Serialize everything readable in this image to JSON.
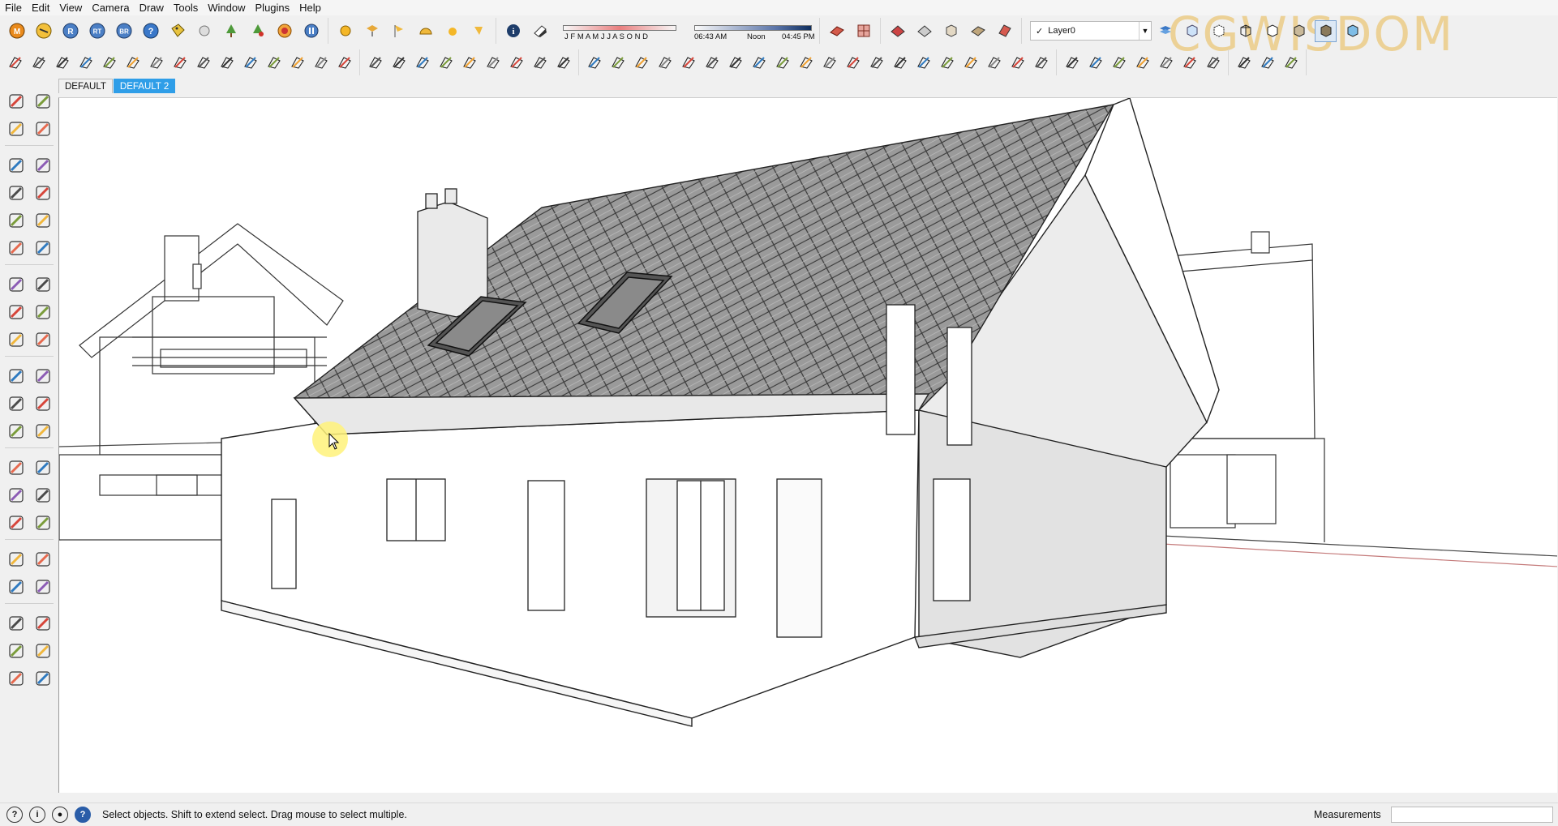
{
  "menu": {
    "file": "File",
    "edit": "Edit",
    "view": "View",
    "camera": "Camera",
    "draw": "Draw",
    "tools": "Tools",
    "window": "Window",
    "plugins": "Plugins",
    "help": "Help"
  },
  "toolbar1": {
    "plugin_letters": [
      "M",
      "R",
      "RT",
      "BR"
    ],
    "shadow": {
      "months": "J F M A M J J A S O N D",
      "time_start": "06:43 AM",
      "noon": "Noon",
      "time_end": "04:45 PM"
    },
    "layer": {
      "checkmark": "✓",
      "name": "Layer0"
    }
  },
  "scenes": {
    "tabs": [
      "DEFAULT",
      "DEFAULT 2"
    ],
    "active_index": 1
  },
  "status": {
    "message": "Select objects. Shift to extend select. Drag mouse to select multiple.",
    "measurements_label": "Measurements",
    "measurements_value": ""
  },
  "watermark": "CGWISDOM",
  "colors": {
    "accent": "#2f9ee8",
    "cursor_highlight": "#fff27a",
    "roof": "#8c8c8c"
  },
  "icons": {
    "left_toolbar": [
      "select-icon",
      "component-icon",
      "paint-bucket-icon",
      "eraser-icon",
      "rectangle-icon",
      "line-icon",
      "circle-icon",
      "freehand-icon",
      "polygon-icon",
      "arc-icon",
      "pie-icon",
      "two-point-arc-icon",
      "move-icon",
      "push-pull-icon",
      "rotate-icon",
      "follow-me-icon",
      "scale-icon",
      "offset-icon",
      "tape-measure-icon",
      "text-icon",
      "protractor-icon",
      "axes-icon",
      "dimension-icon",
      "3d-text-icon",
      "orbit-icon",
      "pan-icon",
      "zoom-icon",
      "zoom-window-icon",
      "zoom-extents-icon",
      "previous-view-icon",
      "position-camera-icon",
      "look-around-icon",
      "walk-icon",
      "section-plane-icon",
      "iso-view-icon",
      "front-view-icon",
      "top-view-icon",
      "right-view-icon",
      "back-view-icon",
      "left-view-icon"
    ]
  }
}
